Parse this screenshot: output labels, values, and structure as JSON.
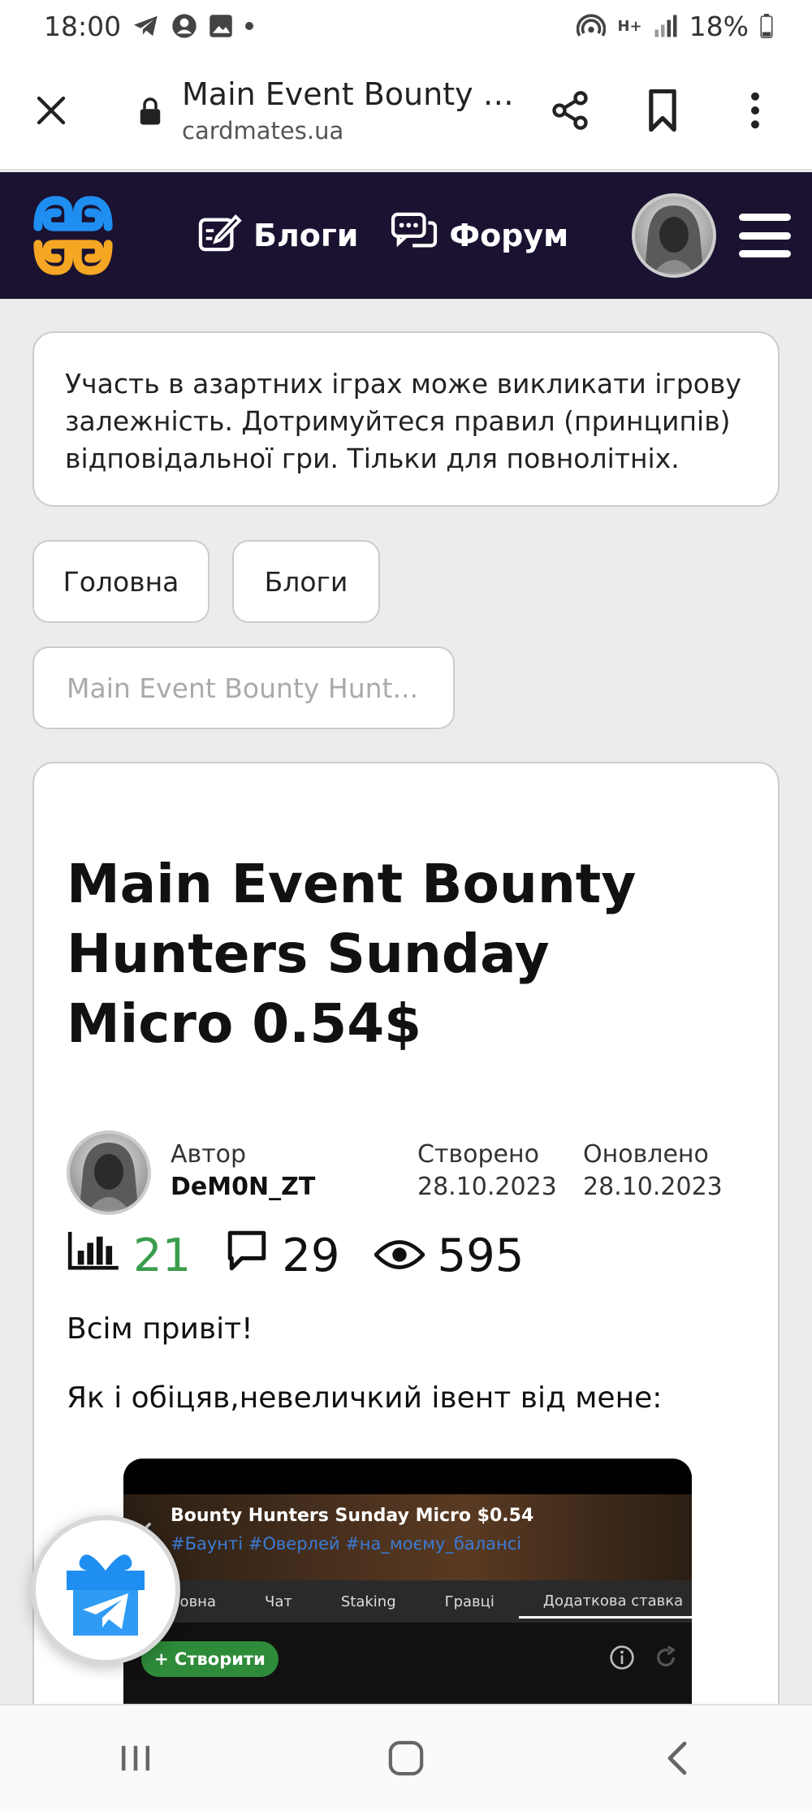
{
  "status_bar": {
    "time": "18:00",
    "battery": "18%",
    "network": "H+",
    "icons": [
      "telegram-icon",
      "account-icon",
      "gallery-icon",
      "dot-icon",
      "hotspot-icon",
      "signal-icon",
      "battery-icon"
    ]
  },
  "browser": {
    "page_title": "Main Event Bounty H...",
    "domain": "cardmates.ua"
  },
  "site_header": {
    "blogs_label": "Блоги",
    "forum_label": "Форум"
  },
  "disclaimer": "Участь в азартних іграх може викликати ігрову залежність. Дотримуйтеся правил (принципів) відповідальної гри. Тільки для повнолітніх.",
  "breadcrumbs": {
    "home": "Головна",
    "blogs": "Блоги",
    "current": "Main Event Bounty Hunt..."
  },
  "article": {
    "title": "Main Event Bounty Hunters Sunday Micro 0.54$",
    "author_label": "Автор",
    "author": "DeM0N_ZT",
    "created_label": "Створено",
    "created": "28.10.2023",
    "updated_label": "Оновлено",
    "updated": "28.10.2023",
    "rating": "21",
    "comments": "29",
    "views": "595",
    "greeting": "Всім привіт!",
    "intro": "Як і обіцяв,невеличкий івент від мене:"
  },
  "embed": {
    "title": "Bounty Hunters Sunday Micro $0.54",
    "tags": "#Баунті  #Оверлей  #на_моєму_балансі",
    "tabs": [
      "/Головна",
      "Чат",
      "Staking",
      "Гравці",
      "Додаткова ставка"
    ],
    "create_label": "+ Створити"
  },
  "colors": {
    "header_bg": "#1a1230",
    "rating_green": "#3a9d4d",
    "logo_blue": "#1f8ef1",
    "logo_orange": "#f5a623"
  }
}
